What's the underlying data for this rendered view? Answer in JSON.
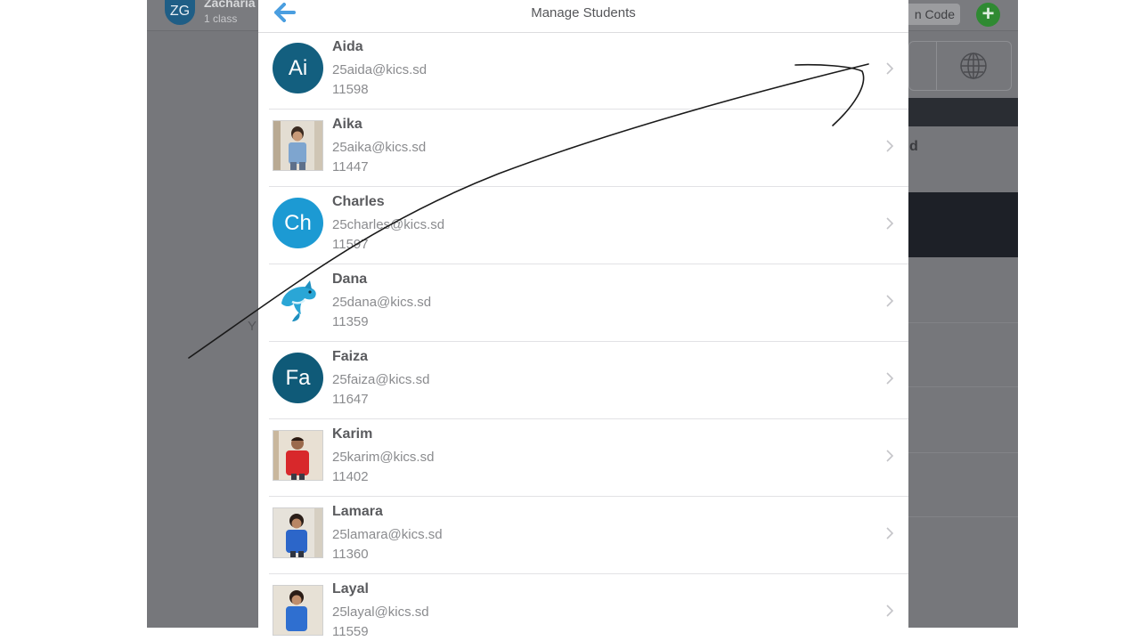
{
  "background_app": {
    "user_initials": "ZG",
    "user_name": "Zacharia",
    "user_subtitle": "1 class",
    "code_button_label": "n Code",
    "add_icon": "plus-circle-icon",
    "side_char_d": "d",
    "side_char_y": "Y"
  },
  "panel": {
    "title": "Manage Students",
    "back_icon": "arrow-left-icon"
  },
  "students": [
    {
      "name": "Aida",
      "email": "25aida@kics.sd",
      "id": "11598",
      "avatar_type": "initials",
      "initials": "Ai",
      "color": "#135f7f"
    },
    {
      "name": "Aika",
      "email": "25aika@kics.sd",
      "id": "11447",
      "avatar_type": "photo",
      "shirt": "#7ea5cf"
    },
    {
      "name": "Charles",
      "email": "25charles@kics.sd",
      "id": "11597",
      "avatar_type": "initials",
      "initials": "Ch",
      "color": "#1c9ad3"
    },
    {
      "name": "Dana",
      "email": "25dana@kics.sd",
      "id": "11359",
      "avatar_type": "emoji",
      "emoji": "dolphin"
    },
    {
      "name": "Faiza",
      "email": "25faiza@kics.sd",
      "id": "11647",
      "avatar_type": "initials",
      "initials": "Fa",
      "color": "#0f5a78"
    },
    {
      "name": "Karim",
      "email": "25karim@kics.sd",
      "id": "11402",
      "avatar_type": "photo",
      "shirt": "#d8282b"
    },
    {
      "name": "Lamara",
      "email": "25lamara@kics.sd",
      "id": "11360",
      "avatar_type": "photo",
      "shirt": "#2c66c9"
    },
    {
      "name": "Layal",
      "email": "25layal@kics.sd",
      "id": "11559",
      "avatar_type": "photo",
      "shirt": "#2f6fd0"
    }
  ],
  "colors": {
    "accent_blue": "#4a9ee0",
    "background_gray": "#76777b",
    "text_dark": "#5a5b5e",
    "text_light": "#8a8b8e"
  }
}
